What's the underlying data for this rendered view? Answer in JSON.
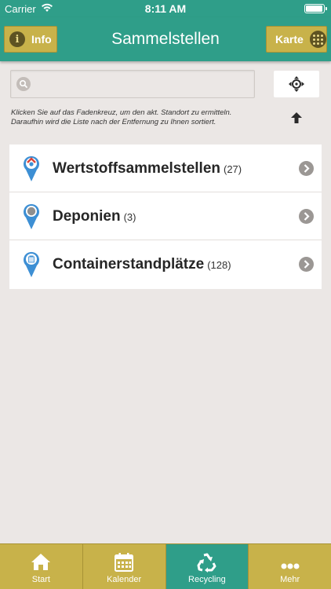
{
  "status_bar": {
    "carrier": "Carrier",
    "time": "8:11 AM"
  },
  "header": {
    "title": "Sammelstellen",
    "info_label": "Info",
    "map_label": "Karte"
  },
  "search": {
    "value": "",
    "placeholder": ""
  },
  "hint": "Klicken Sie auf das Fadenkreuz, um den akt. Standort zu ermitteln. Daraufhin wird die Liste nach der Entfernung zu Ihnen sortiert.",
  "list": [
    {
      "label": "Wertstoffsammelstellen",
      "count": "(27)",
      "icon": "recycling-pin-icon"
    },
    {
      "label": "Deponien",
      "count": "(3)",
      "icon": "landfill-pin-icon"
    },
    {
      "label": "Containerstandplätze",
      "count": "(128)",
      "icon": "container-pin-icon"
    }
  ],
  "tabs": [
    {
      "label": "Start",
      "icon": "home-icon",
      "active": false
    },
    {
      "label": "Kalender",
      "icon": "calendar-icon",
      "active": false
    },
    {
      "label": "Recycling",
      "icon": "recycle-icon",
      "active": true
    },
    {
      "label": "Mehr",
      "icon": "more-icon",
      "active": false
    }
  ],
  "colors": {
    "primary": "#2f9e89",
    "accent": "#c8b24a",
    "background": "#ebe7e5",
    "pin": "#3d8fd4"
  }
}
